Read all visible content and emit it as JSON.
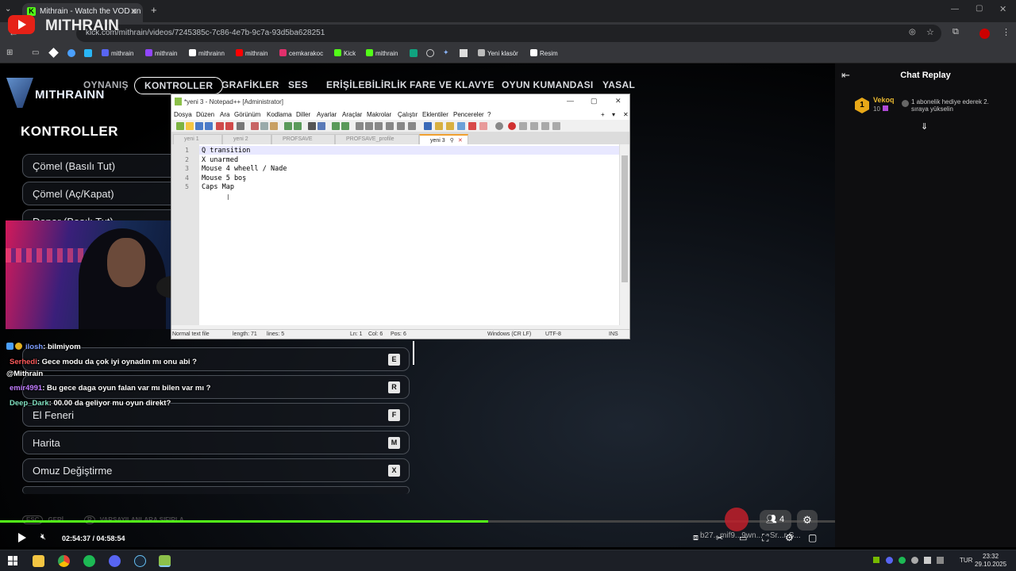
{
  "browser": {
    "tab_title": "Mithrain - Watch the VOD on K",
    "url": "kick.com/mithrain/videos/7245385c-7c86-4e7b-9c7a-93d5ba628251",
    "watermark": "MITHRAIN",
    "bookmarks": [
      {
        "label": "mithrain",
        "color": "#5865f2"
      },
      {
        "label": "mithrain",
        "color": "#9146ff"
      },
      {
        "label": "mithrainn",
        "color": "#ffffff"
      },
      {
        "label": "mithrain",
        "color": "#ff0000"
      },
      {
        "label": "cemkarakoc",
        "color": "#e1306c"
      },
      {
        "label": "Kick",
        "color": "#53fc18"
      },
      {
        "label": "mithrain",
        "color": "#53fc18"
      },
      {
        "label": "Yeni klasör",
        "color": "#bbbbbb"
      },
      {
        "label": "Resim",
        "color": "#ffffff"
      }
    ]
  },
  "game": {
    "logo_text": "MITHRAINN",
    "nav_tabs": [
      "OYNANIŞ",
      "KONTROLLER",
      "GRAFİKLER",
      "SES",
      "ERİŞİLEBİLİRLİK",
      "FARE VE KLAVYE",
      "OYUN KUMANDASI",
      "YASAL"
    ],
    "page_title": "KONTROLLER",
    "rows_top": [
      "Çömel (Basılı Tut)",
      "Çömel (Aç/Kapat)",
      "Depar (Basılı Tut)"
    ],
    "rows_bottom": [
      {
        "label": "El Feneri",
        "key": "F"
      },
      {
        "label": "Harita",
        "key": "M"
      },
      {
        "label": "Omuz Değiştirme",
        "key": "X"
      }
    ],
    "partial_keys": [
      "E",
      "R"
    ],
    "footer_back": "GERİ",
    "footer_reset": "VARSAYILANLARA SIFIRLA"
  },
  "notepad": {
    "title": "*yeni 3 - Notepad++ [Administrator]",
    "menu": [
      "Dosya",
      "Düzen",
      "Ara",
      "Görünüm",
      "Kodlama",
      "Diller",
      "Ayarlar",
      "Araçlar",
      "Makrolar",
      "Çalıştır",
      "Eklentiler",
      "Pencereler",
      "?"
    ],
    "tabs": [
      "yeni 1",
      "yeni 2",
      "PROFSAVE",
      "PROFSAVE_profile",
      "yeni 3"
    ],
    "lines": [
      "Q transition",
      "X unarmed",
      "Mouse 4 wheell / Nade",
      "Mouse 5 boş",
      "Caps Map"
    ],
    "line_numbers": [
      "1",
      "2",
      "3",
      "4",
      "5"
    ],
    "status": {
      "type": "Normal text file",
      "length": "length: 71",
      "lines": "lines: 5",
      "ln": "Ln: 1",
      "col": "Col: 6",
      "pos": "Pos: 6",
      "eol": "Windows (CR LF)",
      "enc": "UTF-8",
      "mode": "INS"
    }
  },
  "chat_overlay": [
    {
      "user": "ilosh",
      "text": ": bilmiyom",
      "color": "#7b9cff"
    },
    {
      "user": "Serhedi",
      "text": ": Gece modu da çok iyi oynadın mı onu abi ?",
      "color": "#ff5a5a"
    },
    {
      "user": "",
      "text": "@Mithrain",
      "color": "#ffffff"
    },
    {
      "user": "emir4991",
      "text": ": Bu gece daga oyun falan var mı bilen var mı ?",
      "color": "#c07cff"
    },
    {
      "user": "Deep_Dark",
      "text": ": 00.00 da geliyor mu oyun direkt?",
      "color": "#7fe0c0"
    }
  ],
  "chat_replay": {
    "title": "Chat Replay",
    "user": "Vekoq",
    "months": "10",
    "gift_text_1": "1 abonelik hediye ederek 2.",
    "gift_text_2": "sıraya yükselin",
    "rank": "1"
  },
  "player": {
    "time": "02:54:37 / 04:58:54",
    "progress": 0.585,
    "viewers": "4",
    "bottom_text": "b27...mif9...9wn... - Sr...r S..."
  },
  "taskbar": {
    "time": "23:32",
    "date": "29.10.2025",
    "lang": "TUR"
  }
}
